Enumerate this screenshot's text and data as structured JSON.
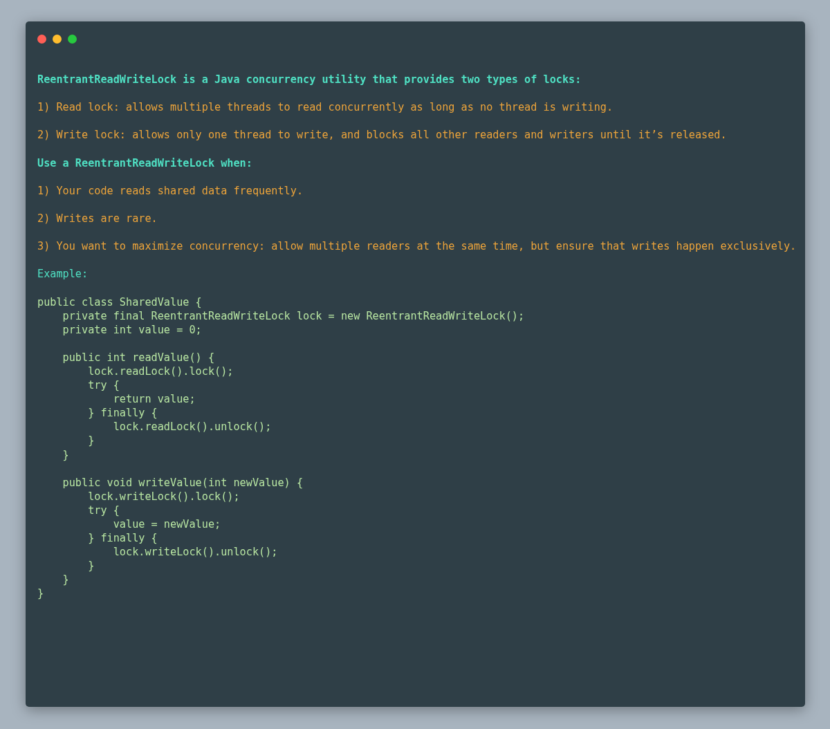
{
  "window": {
    "controls": [
      {
        "color": "#ff5f56"
      },
      {
        "color": "#ffbd2e"
      },
      {
        "color": "#27c93f"
      }
    ]
  },
  "prose": [
    {
      "kind": "heading",
      "text": "ReentrantReadWriteLock is a Java concurrency utility that provides two types of locks:"
    },
    {
      "kind": "item",
      "text": "1) Read lock: allows multiple threads to read concurrently as long as no thread is writing."
    },
    {
      "kind": "item",
      "text": "2) Write lock: allows only one thread to write, and blocks all other readers and writers until it’s released."
    },
    {
      "kind": "heading",
      "text": "Use a ReentrantReadWriteLock when:"
    },
    {
      "kind": "item",
      "text": "1) Your code reads shared data frequently."
    },
    {
      "kind": "item",
      "text": "2) Writes are rare."
    },
    {
      "kind": "item",
      "text": "3) You want to maximize concurrency: allow multiple readers at the same time, but ensure that writes happen exclusively."
    }
  ],
  "example": {
    "label": "Example:",
    "code_blocks": [
      [
        "public class SharedValue {",
        "    private final ReentrantReadWriteLock lock = new ReentrantReadWriteLock();",
        "    private int value = 0;"
      ],
      [
        "    public int readValue() {",
        "        lock.readLock().lock();",
        "        try {",
        "            return value;",
        "        } finally {",
        "            lock.readLock().unlock();",
        "        }",
        "    }"
      ],
      [
        "    public void writeValue(int newValue) {",
        "        lock.writeLock().lock();",
        "        try {",
        "            value = newValue;",
        "        } finally {",
        "            lock.writeLock().unlock();",
        "        }",
        "    }",
        "}"
      ]
    ]
  }
}
